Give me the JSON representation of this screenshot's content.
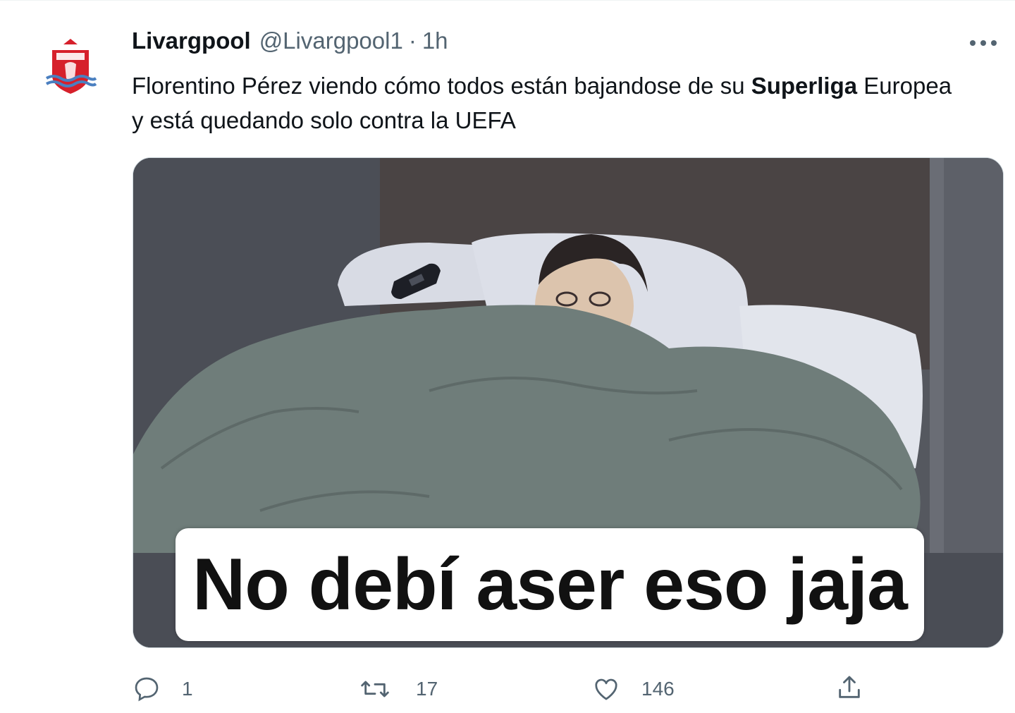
{
  "tweet": {
    "display_name": "Livargpool",
    "handle": "@Livargpool1",
    "separator": "·",
    "time": "1h",
    "text_before": "Florentino Pérez viendo cómo todos están bajandose de su ",
    "text_bold": "Superliga",
    "text_after": " Europea y está quedando solo contra la UEFA",
    "avatar_icon": "liverpool-crest-icon",
    "more_icon": "more-dots-icon"
  },
  "media": {
    "caption": "No debí aser eso jaja",
    "colors": {
      "blanket": "#6f7d7a",
      "wall": "#5a5d66",
      "pillow": "#d8dbe4"
    }
  },
  "actions": {
    "reply": {
      "icon": "reply-icon",
      "count": "1"
    },
    "retweet": {
      "icon": "retweet-icon",
      "count": "17"
    },
    "like": {
      "icon": "heart-icon",
      "count": "146"
    },
    "share": {
      "icon": "share-icon"
    }
  },
  "colors": {
    "secondary_text": "#536471",
    "primary_text": "#0f1419",
    "crest_red": "#d6202b"
  }
}
